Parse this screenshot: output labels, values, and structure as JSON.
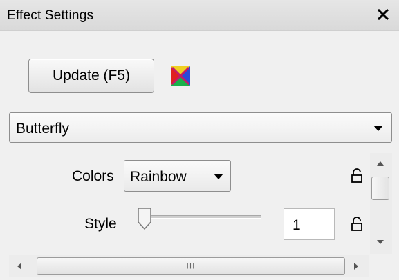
{
  "window": {
    "title": "Effect Settings",
    "close_icon": "close-icon"
  },
  "toolbar": {
    "update_label": "Update (F5)",
    "effect_icon": "butterfly-effect-icon"
  },
  "effect": {
    "selected": "Butterfly"
  },
  "settings": {
    "colors": {
      "label": "Colors",
      "selected": "Rainbow",
      "lock_icon": "lock-icon"
    },
    "style": {
      "label": "Style",
      "slider_value": 1,
      "value": "1",
      "lock_icon": "lock-icon"
    }
  },
  "scrollbars": {
    "horizontal_grip": "III"
  },
  "colors": {
    "icon_red": "#e02020",
    "icon_green": "#19b14a",
    "icon_blue": "#2a4ad9",
    "icon_yellow": "#f0d020"
  }
}
